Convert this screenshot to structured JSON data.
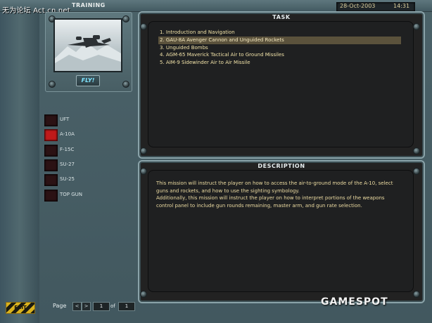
{
  "watermark_top": "无为论坛 Act.cn.net",
  "header": {
    "title": "TRAINING",
    "date": "28-Oct-2003",
    "time": "14:31"
  },
  "preview": {
    "fly_label": "FLY!"
  },
  "aircraft": [
    {
      "label": "UFT",
      "selected": false
    },
    {
      "label": "A-10A",
      "selected": true
    },
    {
      "label": "F-15C",
      "selected": false
    },
    {
      "label": "SU-27",
      "selected": false
    },
    {
      "label": "SU-25",
      "selected": false
    },
    {
      "label": "TOP GUN",
      "selected": false
    }
  ],
  "task_panel": {
    "header": "TASK",
    "items": [
      {
        "label": "1. Introduction and Navigation",
        "selected": false
      },
      {
        "label": "2. GAU-8A Avenger Cannon and Unguided Rockets",
        "selected": true
      },
      {
        "label": "3. Unguided Bombs",
        "selected": false
      },
      {
        "label": "4. AGM-65 Maverick Tactical Air to Ground Missiles",
        "selected": false
      },
      {
        "label": "5. AIM-9 Sidewinder Air to Air Missile",
        "selected": false
      }
    ]
  },
  "description_panel": {
    "header": "DESCRIPTION",
    "text": "This mission will instruct the player on how to access the air-to-ground mode of the A-10, select guns and rockets, and how to use the sighting symbology.\nAdditionally, this mission will instruct the player on how to interpret portions of the weapons control panel to include gun rounds remaining, master arm, and gun rate selection."
  },
  "footer": {
    "page_label": "Page",
    "prev": "<",
    "next": ">",
    "current_page": "1",
    "of_label": "of",
    "total_pages": "1",
    "exit_label": "EXIT"
  },
  "watermark_bottom": "GAMESPOT",
  "colors": {
    "selected_aircraft": "#c01a1a",
    "text_accent": "#f1e2a8"
  }
}
